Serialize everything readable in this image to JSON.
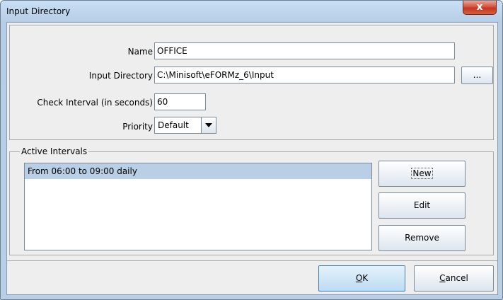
{
  "window": {
    "title": "Input Directory",
    "close_label": "x"
  },
  "form": {
    "name_label": "Name",
    "name_value": "OFFICE",
    "input_dir_label": "Input Directory",
    "input_dir_value": "C:\\Minisoft\\eFORMz_6\\Input",
    "browse_label": "...",
    "check_interval_label": "Check Interval (in seconds)",
    "check_interval_value": "60",
    "priority_label": "Priority",
    "priority_value": "Default"
  },
  "intervals": {
    "group_title": "Active Intervals",
    "items": [
      "From 06:00 to 09:00 daily"
    ],
    "new_label": "New",
    "edit_label": "Edit",
    "remove_label": "Remove"
  },
  "footer": {
    "ok_mnemonic": "O",
    "ok_rest": "K",
    "cancel_mnemonic": "C",
    "cancel_rest": "ancel"
  },
  "colors": {
    "selection": "#b8cfe5",
    "titlebar": "#c9dff4",
    "close": "#c3371f"
  }
}
